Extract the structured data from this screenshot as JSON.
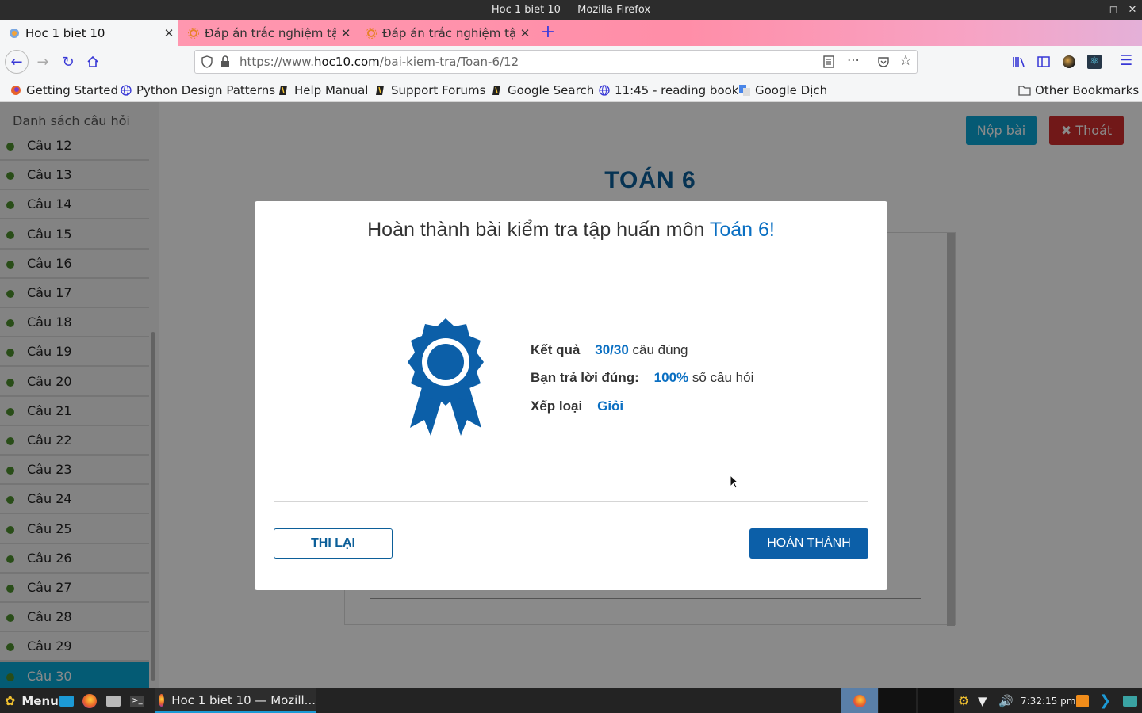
{
  "window": {
    "title": "Hoc 1 biet 10 — Mozilla Firefox"
  },
  "tabs": [
    {
      "label": "Hoc 1 biet 10"
    },
    {
      "label": "Đáp án trắc nghiệm tập"
    },
    {
      "label": "Đáp án trắc nghiệm tập"
    }
  ],
  "url": {
    "prefix": "https://www.",
    "domain": "hoc10.com",
    "path": "/bai-kiem-tra/Toan-6/12"
  },
  "bookmarks": [
    "Getting Started",
    "Python Design Patterns",
    "Help Manual",
    "Support Forums",
    "Google Search",
    "11:45 - reading book",
    "Google Dịch"
  ],
  "other_bookmarks": "Other Bookmarks",
  "sidebar": {
    "heading": "Danh sách câu hỏi",
    "items": [
      "Câu 12",
      "Câu 13",
      "Câu 14",
      "Câu 15",
      "Câu 16",
      "Câu 17",
      "Câu 18",
      "Câu 19",
      "Câu 20",
      "Câu 21",
      "Câu 22",
      "Câu 23",
      "Câu 24",
      "Câu 25",
      "Câu 26",
      "Câu 27",
      "Câu 28",
      "Câu 29",
      "Câu 30"
    ],
    "active": "Câu 30"
  },
  "header": {
    "title": "TOÁN 6",
    "submit_label": "Nộp bài",
    "exit_label": "Thoát"
  },
  "modal": {
    "title_prefix": "Hoàn thành bài kiểm tra tập huấn môn ",
    "title_highlight": "Toán 6!",
    "result_label": "Kết quả",
    "result_value": "30/30",
    "result_suffix": "câu đúng",
    "correct_label": "Bạn trả lời đúng:",
    "correct_value": "100%",
    "correct_suffix": "số câu hỏi",
    "rank_label": "Xếp loại",
    "rank_value": "Giỏi",
    "retry_label": "THI LẠI",
    "done_label": "HOÀN THÀNH"
  },
  "taskbar": {
    "menu_label": "Menu",
    "window_label": "Hoc 1 biet 10 — Mozill...",
    "clock": "7:32:15 pm"
  },
  "colors": {
    "accent": "#0a6fc2",
    "active_item": "#08a9d6",
    "exit": "#d12d2d",
    "submit": "#0aa7d6"
  }
}
